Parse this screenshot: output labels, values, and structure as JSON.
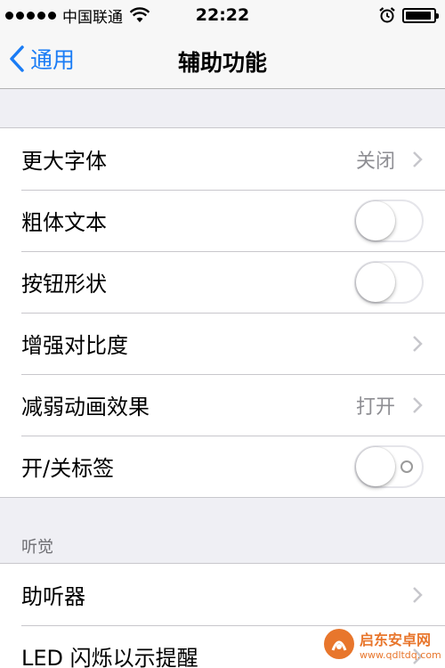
{
  "status_bar": {
    "carrier": "中国联通",
    "time": "22:22",
    "battery_level": 0.92
  },
  "nav": {
    "back_label": "通用",
    "title": "辅助功能"
  },
  "group1": {
    "rows": [
      {
        "label": "更大字体",
        "value": "关闭",
        "control": "chevron"
      },
      {
        "label": "粗体文本",
        "control": "toggle",
        "on": false
      },
      {
        "label": "按钮形状",
        "control": "toggle",
        "on": false
      },
      {
        "label": "增强对比度",
        "control": "chevron"
      },
      {
        "label": "减弱动画效果",
        "value": "打开",
        "control": "chevron"
      },
      {
        "label": "开/关标签",
        "control": "toggle",
        "on": false
      }
    ]
  },
  "hearing": {
    "header": "听觉",
    "rows": [
      {
        "label": "助听器",
        "control": "chevron"
      },
      {
        "label": "LED 闪烁以示提醒",
        "control": "chevron"
      }
    ]
  },
  "watermark": {
    "name": "启东安卓网",
    "url": "www.qdltdq.com"
  },
  "colors": {
    "accent": "#1a7cf5",
    "background": "#efeff4",
    "secondary_text": "#8e8e93"
  }
}
